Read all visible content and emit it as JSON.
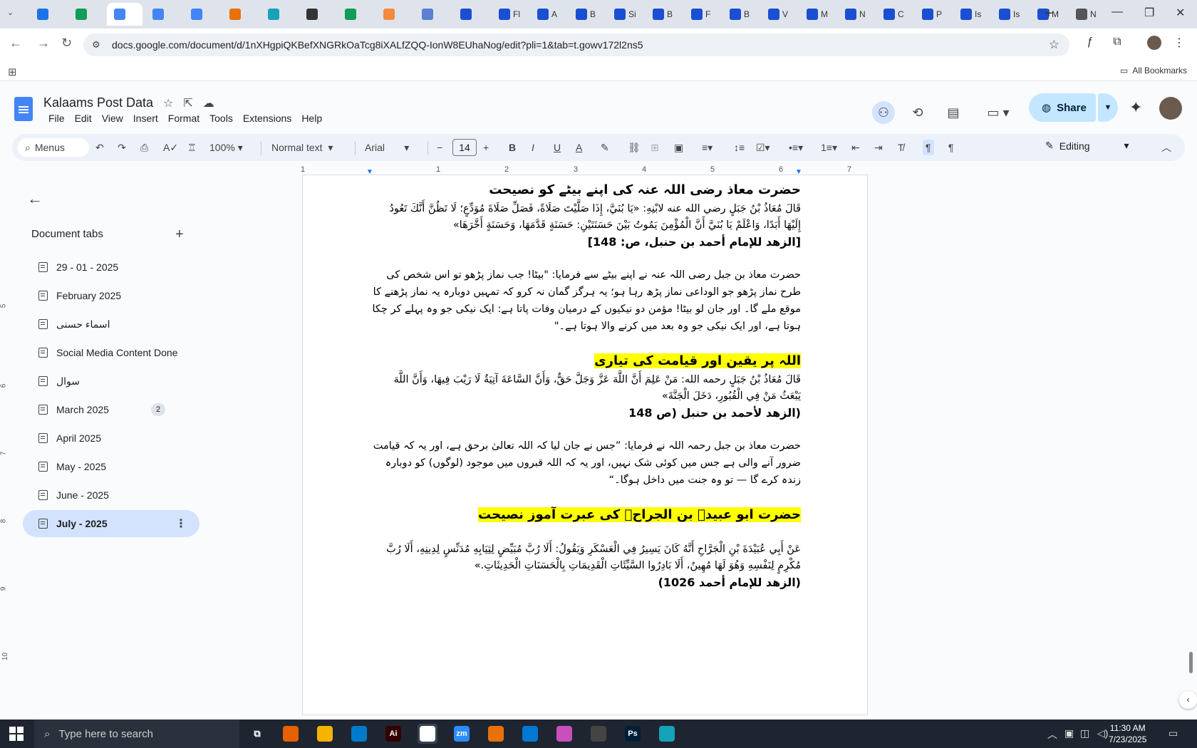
{
  "browser": {
    "tabs": [
      {
        "icon": "logo-icon",
        "label": "",
        "color": "#1a73e8"
      },
      {
        "icon": "sheets-icon",
        "label": "",
        "color": "#0f9d58"
      },
      {
        "icon": "docs-icon",
        "label": "",
        "color": "#4285f4",
        "active": true
      },
      {
        "icon": "docs-icon",
        "label": "",
        "color": "#4285f4"
      },
      {
        "icon": "docs-icon",
        "label": "",
        "color": "#4285f4"
      },
      {
        "icon": "app-icon",
        "label": "",
        "color": "#e8710a"
      },
      {
        "icon": "app-icon",
        "label": "",
        "color": "#16a2b8"
      },
      {
        "icon": "openai-icon",
        "label": "",
        "color": "#333333"
      },
      {
        "icon": "sheets-icon",
        "label": "",
        "color": "#0f9d58"
      },
      {
        "icon": "app-icon",
        "label": "",
        "color": "#f28b40"
      },
      {
        "icon": "app-icon",
        "label": "",
        "color": "#5b7fd1"
      },
      {
        "icon": "docs-icon",
        "label": "",
        "color": "#1a4fd1"
      },
      {
        "icon": "docs-icon",
        "label": "Fl",
        "color": "#1a4fd1"
      },
      {
        "icon": "docs-icon",
        "label": "A",
        "color": "#1a4fd1"
      },
      {
        "icon": "docs-icon",
        "label": "B",
        "color": "#1a4fd1"
      },
      {
        "icon": "docs-icon",
        "label": "Si",
        "color": "#1a4fd1"
      },
      {
        "icon": "docs-icon",
        "label": "B",
        "color": "#1a4fd1"
      },
      {
        "icon": "docs-icon",
        "label": "F",
        "color": "#1a4fd1"
      },
      {
        "icon": "docs-icon",
        "label": "B",
        "color": "#1a4fd1"
      },
      {
        "icon": "docs-icon",
        "label": "V",
        "color": "#1a4fd1"
      },
      {
        "icon": "docs-icon",
        "label": "M",
        "color": "#1a4fd1"
      },
      {
        "icon": "docs-icon",
        "label": "N",
        "color": "#1a4fd1"
      },
      {
        "icon": "docs-icon",
        "label": "C",
        "color": "#1a4fd1"
      },
      {
        "icon": "docs-icon",
        "label": "P",
        "color": "#1a4fd1"
      },
      {
        "icon": "docs-icon",
        "label": "Is",
        "color": "#1a4fd1"
      },
      {
        "icon": "docs-icon",
        "label": "Is",
        "color": "#1a4fd1"
      },
      {
        "icon": "docs-icon",
        "label": "M",
        "color": "#1a4fd1"
      },
      {
        "icon": "chrome-icon",
        "label": "N",
        "color": "#555555"
      }
    ],
    "url": "docs.google.com/document/d/1nXHgpiQKBefXNGRkOaTcg8iXALfZQQ-IonW8EUhaNog/edit?pli=1&tab=t.gowv172l2ns5",
    "bookmarks_label": "All Bookmarks"
  },
  "docs": {
    "title": "Kalaams Post Data",
    "menu": [
      "File",
      "Edit",
      "View",
      "Insert",
      "Format",
      "Tools",
      "Extensions",
      "Help"
    ],
    "share_label": "Share",
    "toolbar": {
      "menus_label": "Menus",
      "zoom": "100%",
      "style": "Normal text",
      "font": "Arial",
      "font_size": "14",
      "mode": "Editing"
    },
    "ruler_numbers": [
      "1",
      "1",
      "2",
      "3",
      "4",
      "5",
      "6",
      "7"
    ],
    "vruler_numbers": [
      "5",
      "6",
      "7",
      "8",
      "9",
      "10"
    ]
  },
  "sidebar": {
    "heading": "Document tabs",
    "tabs": [
      {
        "label": "29 - 01 - 2025"
      },
      {
        "label": "February 2025"
      },
      {
        "label": "اسماء حسنی"
      },
      {
        "label": "Social Media Content Done"
      },
      {
        "label": "سوال"
      },
      {
        "label": "March 2025",
        "badge": "2"
      },
      {
        "label": "April 2025"
      },
      {
        "label": "May - 2025"
      },
      {
        "label": "June - 2025"
      },
      {
        "label": "July - 2025",
        "active": true
      }
    ]
  },
  "document": {
    "heading1": "حضرت معاذ رضی اللہ عنہ کی اپنے بیٹے کو نصیحت",
    "arabic1": "قَالَ مُعَاذُ بْنُ جَبَلٍ رضي الله عنه لابْنِهِ: «يَا بُنَيَّ، إِذَا صَلَّيْتَ صَلَاةً، فَصَلِّ صَلَاةَ مُوَدِّعٍ؛ لَا تَظُنَّ أَنَّكَ تَعُودُ إِلَيْهَا أَبَدًا، وَاعْلَمْ يَا بُنَيَّ أَنَّ الْمُؤْمِنَ يَمُوتُ بَيْنَ حَسَنَتَيْنِ: حَسَنَةٍ قَدَّمَهَا، وَحَسَنَةٍ أَخَّرَهَا»",
    "ref1": "[الزهد للإمام أحمد بن حنبل، ص: 148]",
    "urdu1": "حضرت معاذ بن جبل رضی اللہ عنہ نے اپنے بیٹے سے فرمایا: \"بیٹا! جب نماز پڑھو تو اس شخص کی طرح نماز پڑھو جو الوداعی نماز پڑھ رہا ہو؛ یہ ہرگز گمان نہ کرو کہ تمہیں دوبارہ یہ نماز پڑھنے کا موقع ملے گا۔ اور جان لو بیٹا! مؤمن دو نیکیوں کے درمیان وفات پاتا ہے: ایک نیکی جو وہ پہلے کر چکا ہوتا ہے، اور ایک نیکی جو وہ بعد میں کرنے والا ہوتا ہے۔\"",
    "heading2": "اللہ پر یقین اور قیامت کی تیاری",
    "arabic2": "قَالَ مُعَاذُ بْنُ جَبَلٍ رحمه الله: مَنْ عَلِمَ أَنَّ اللَّهَ عَزَّ وَجَلَّ حَقٌّ، وَأَنَّ السَّاعَةَ آتِيَةٌ لَا رَيْبَ فِيهَا، وَأَنَّ اللَّهَ يَبْعَثُ مَنْ فِي الْقُبُورِ، دَخَلَ الْجَنَّةَ»",
    "ref2": "(الزهد لأحمد بن حنبل (ص 148",
    "urdu2": "حضرت معاذ بن جبل رحمہ اللہ نے فرمایا: ”جس نے جان لیا کہ اللہ تعالیٰ برحق ہے، اور یہ کہ قیامت ضرور آنے والی ہے جس میں کوئی شک نہیں، اور یہ کہ اللہ قبروں میں موجود (لوگوں) کو دوبارہ زندہ کرے گا — تو وہ جنت میں داخل ہوگا۔“",
    "heading3": "حضرت ابو عبیدہ بن الجراحؓ کی عبرت آموز نصیحت",
    "arabic3": "عَنْ أَبِي عُبَيْدَةَ بْنِ الْجَرَّاحِ أَنَّهُ كَانَ يَسِيرُ فِي الْعَسْكَرِ وَيَقُولُ: أَلَا رُبَّ مُبَيِّضٍ لِثِيَابِهِ مُدَنِّسٍ لِدِينِهِ، أَلَا رُبَّ مُكْرِمٍ لِنَفْسِهِ وَهُوَ لَهَا مُهِينٌ، أَلَا بَادِرُوا السَّيِّئَاتِ الْقَدِيمَاتِ بِالْحَسَنَاتِ الْحَدِيثَاتِ.»",
    "ref3": "(الزهد للإمام أحمد 1026)"
  },
  "taskbar": {
    "search_placeholder": "Type here to search",
    "apps": [
      "firefox-icon",
      "file-explorer-icon",
      "vscode-icon",
      "illustrator-icon",
      "chrome-icon",
      "zoom-icon",
      "app-icon",
      "outlook-icon",
      "app-icon",
      "pen-icon",
      "photoshop-icon",
      "app-icon"
    ],
    "app_labels": [
      "",
      "",
      "",
      "Ai",
      "",
      "zm",
      "",
      "",
      "",
      "",
      "Ps",
      ""
    ],
    "time": "11:30 AM",
    "date": "7/23/2025"
  }
}
